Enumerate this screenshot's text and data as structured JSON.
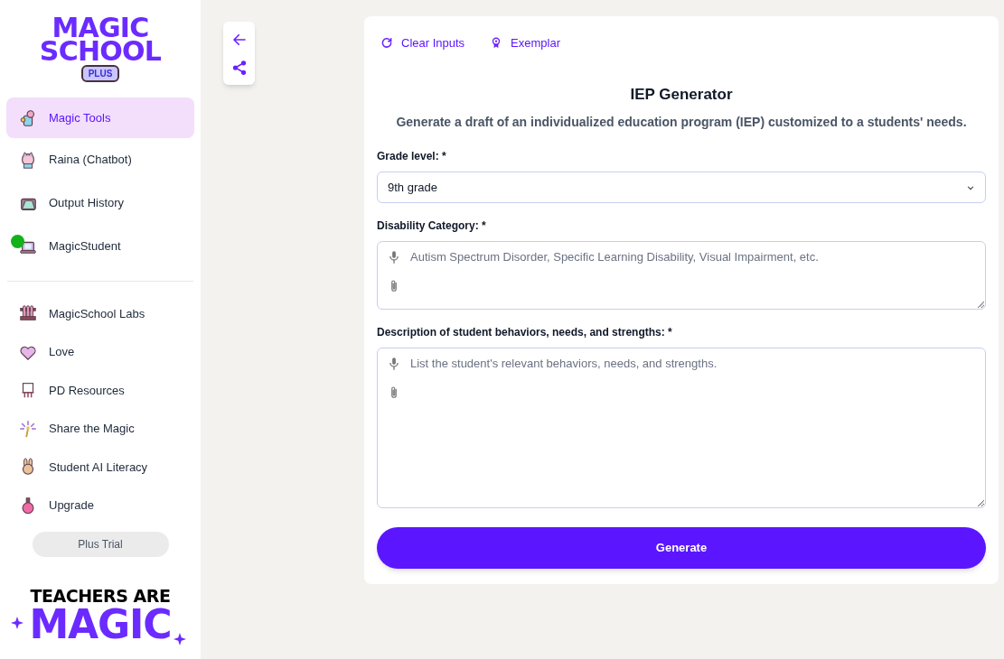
{
  "sidebar": {
    "logo": {
      "line_1": "MAGIC",
      "line_2": "SCHOOL",
      "badge": "PLUS"
    },
    "items": [
      {
        "label": "Magic Tools",
        "selected": true,
        "notification_dot": false
      },
      {
        "label": "Raina (Chatbot)",
        "selected": false,
        "notification_dot": false
      },
      {
        "label": "Output History",
        "selected": false,
        "notification_dot": false
      },
      {
        "label": "MagicStudent",
        "selected": false,
        "notification_dot": true
      }
    ],
    "more_items": [
      {
        "label": "MagicSchool Labs",
        "selected": false
      },
      {
        "label": "Love",
        "selected": false
      },
      {
        "label": "PD Resources",
        "selected": false
      },
      {
        "label": "Share the Magic",
        "selected": false
      },
      {
        "label": "Student AI Literacy",
        "selected": false
      },
      {
        "label": "Upgrade",
        "selected": false
      }
    ],
    "plan_button": "Plus Trial",
    "footer_logo": {
      "line_1": "TEACHERS ARE",
      "line_2": "MAGIC"
    }
  },
  "toolbar": {
    "actions": [
      "Clear Inputs",
      "Exemplar"
    ]
  },
  "tool": {
    "title": "IEP Generator",
    "description": "Generate a draft of an individualized education program (IEP) customized to a students' needs.",
    "fields": [
      {
        "kind": "select",
        "label": "Grade level: *",
        "value": "9th grade"
      },
      {
        "kind": "textarea",
        "label": "Disability Category: *",
        "placeholder": "Autism Spectrum Disorder, Specific Learning Disability, Visual Impairment, etc."
      },
      {
        "kind": "textarea",
        "label": "Description of student behaviors, needs, and strengths: *",
        "placeholder": "List the student's relevant behaviors, needs, and strengths."
      }
    ],
    "submit": "Generate"
  }
}
